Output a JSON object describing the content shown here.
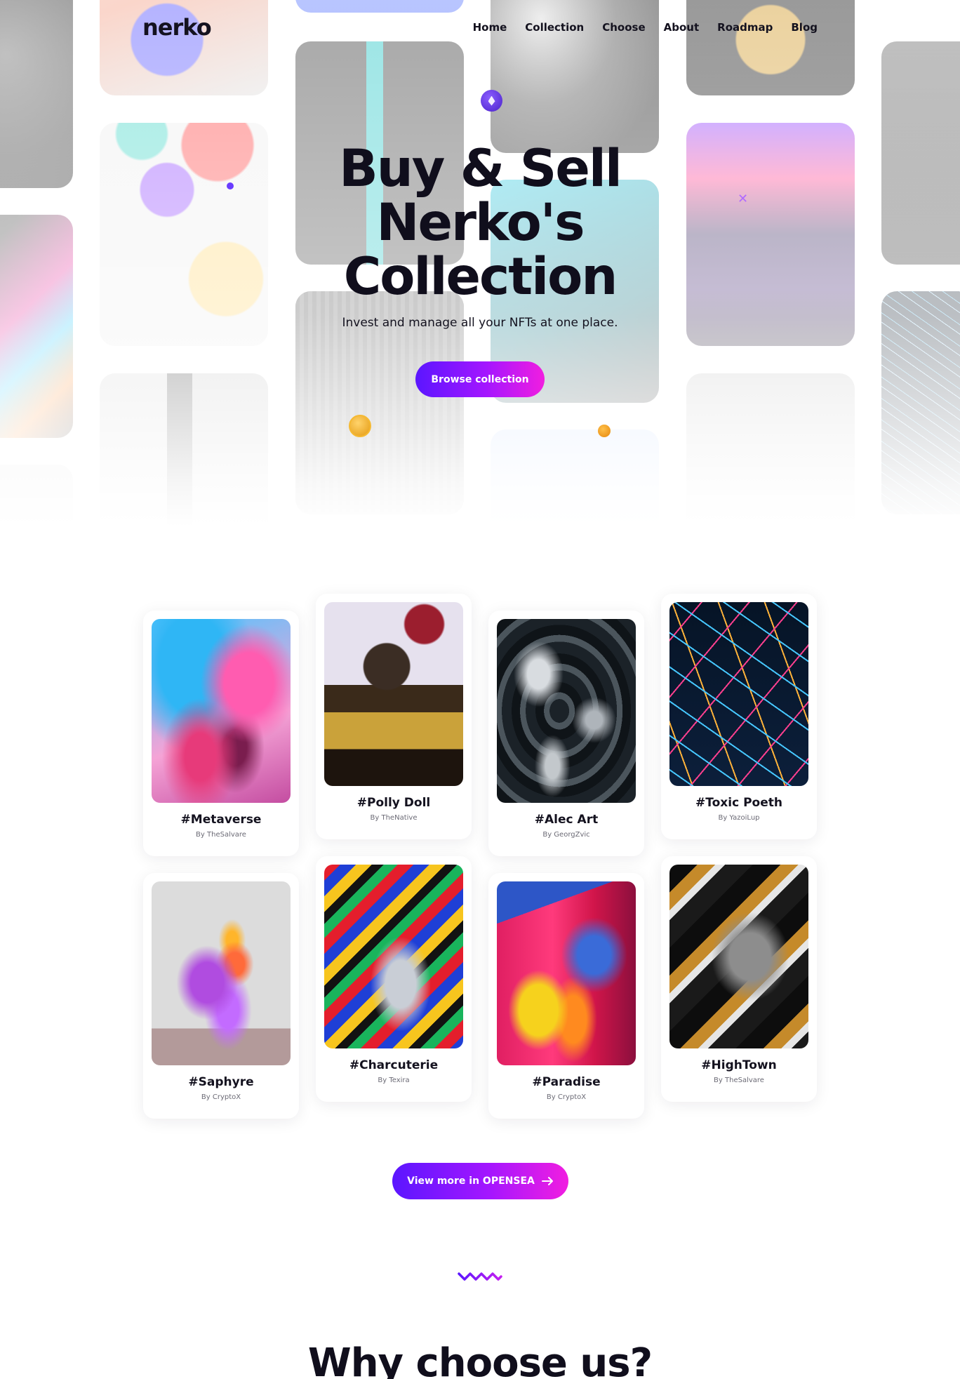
{
  "brand": {
    "logo": "nerko"
  },
  "nav": {
    "items": [
      {
        "label": "Home"
      },
      {
        "label": "Collection"
      },
      {
        "label": "Choose"
      },
      {
        "label": "About"
      },
      {
        "label": "Roadmap"
      },
      {
        "label": "Blog"
      }
    ]
  },
  "hero": {
    "title_line1": "Buy & Sell",
    "title_line2": "Nerko's",
    "title_line3": "Collection",
    "subtitle": "Invest and manage all your NFTs at one place.",
    "cta_label": "Browse collection"
  },
  "collection": {
    "items": [
      {
        "name": "#Metaverse",
        "author": "By TheSalvare"
      },
      {
        "name": "#Polly Doll",
        "author": "By TheNative"
      },
      {
        "name": "#Alec Art",
        "author": "By GeorgZvic"
      },
      {
        "name": "#Toxic Poeth",
        "author": "By YazoiLup"
      },
      {
        "name": "#Saphyre",
        "author": "By CryptoX"
      },
      {
        "name": "#Charcuterie",
        "author": "By Texira"
      },
      {
        "name": "#Paradise",
        "author": "By CryptoX"
      },
      {
        "name": "#HighTown",
        "author": "By TheSalvare"
      }
    ],
    "more_label": "View more in OPENSEA"
  },
  "why": {
    "title": "Why choose us?"
  },
  "colors": {
    "gradient_start": "#5b16ff",
    "gradient_mid": "#a416ff",
    "gradient_end": "#f11ee0",
    "text_dark": "#14121f"
  }
}
